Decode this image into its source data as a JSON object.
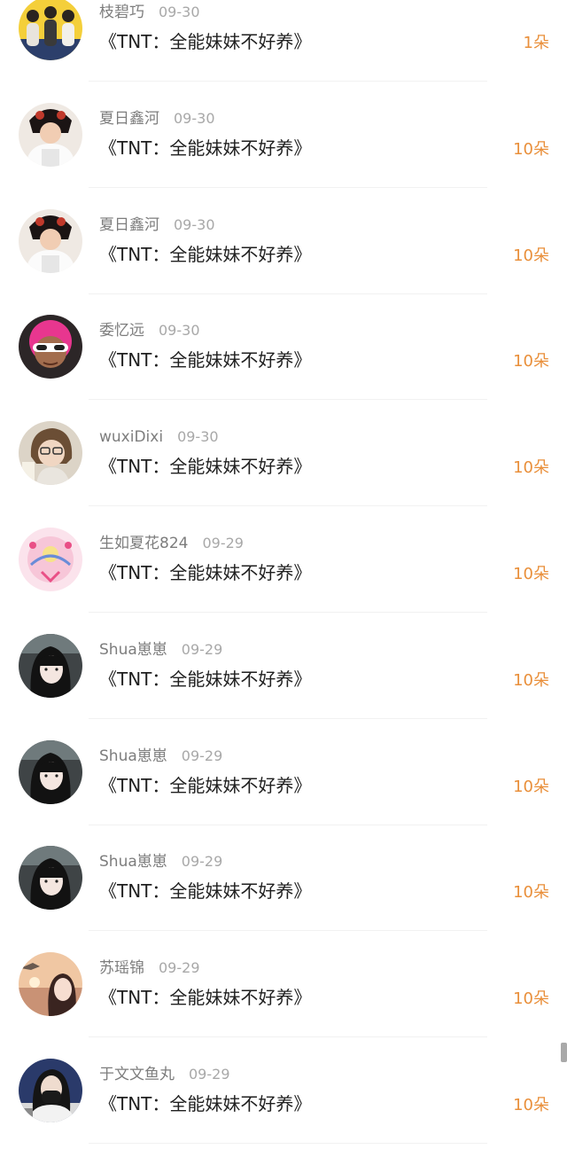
{
  "colors": {
    "amount": "#e98f3a",
    "username": "#7d7d7d",
    "date": "#a8a8a8",
    "title": "#1f1f1f"
  },
  "gift_records": [
    {
      "username": "枝碧巧",
      "date": "09-30",
      "gift": "《TNT：全能妹妹不好养》",
      "amount": "1朵",
      "avatar": "group-photo-avatar"
    },
    {
      "username": "夏日鑫河",
      "date": "09-30",
      "gift": "《TNT：全能妹妹不好养》",
      "amount": "10朵",
      "avatar": "costume-portrait-avatar"
    },
    {
      "username": "夏日鑫河",
      "date": "09-30",
      "gift": "《TNT：全能妹妹不好养》",
      "amount": "10朵",
      "avatar": "costume-portrait-avatar"
    },
    {
      "username": "委忆远",
      "date": "09-30",
      "gift": "《TNT：全能妹妹不好养》",
      "amount": "10朵",
      "avatar": "pink-hair-cartoon-avatar"
    },
    {
      "username": "wuxiDixi",
      "date": "09-30",
      "gift": "《TNT：全能妹妹不好养》",
      "amount": "10朵",
      "avatar": "glasses-selfie-avatar"
    },
    {
      "username": "生如夏花824",
      "date": "09-29",
      "gift": "《TNT：全能妹妹不好养》",
      "amount": "10朵",
      "avatar": "sailor-moon-avatar"
    },
    {
      "username": "Shua崽崽",
      "date": "09-29",
      "gift": "《TNT：全能妹妹不好养》",
      "amount": "10朵",
      "avatar": "dark-hair-portrait-avatar"
    },
    {
      "username": "Shua崽崽",
      "date": "09-29",
      "gift": "《TNT：全能妹妹不好养》",
      "amount": "10朵",
      "avatar": "dark-hair-portrait-avatar"
    },
    {
      "username": "Shua崽崽",
      "date": "09-29",
      "gift": "《TNT：全能妹妹不好养》",
      "amount": "10朵",
      "avatar": "dark-hair-portrait-avatar"
    },
    {
      "username": "苏瑶锦",
      "date": "09-29",
      "gift": "《TNT：全能妹妹不好养》",
      "amount": "10朵",
      "avatar": "sunset-portrait-avatar"
    },
    {
      "username": "于文文鱼丸",
      "date": "09-29",
      "gift": "《TNT：全能妹妹不好养》",
      "amount": "10朵",
      "avatar": "masked-selfie-avatar"
    }
  ]
}
